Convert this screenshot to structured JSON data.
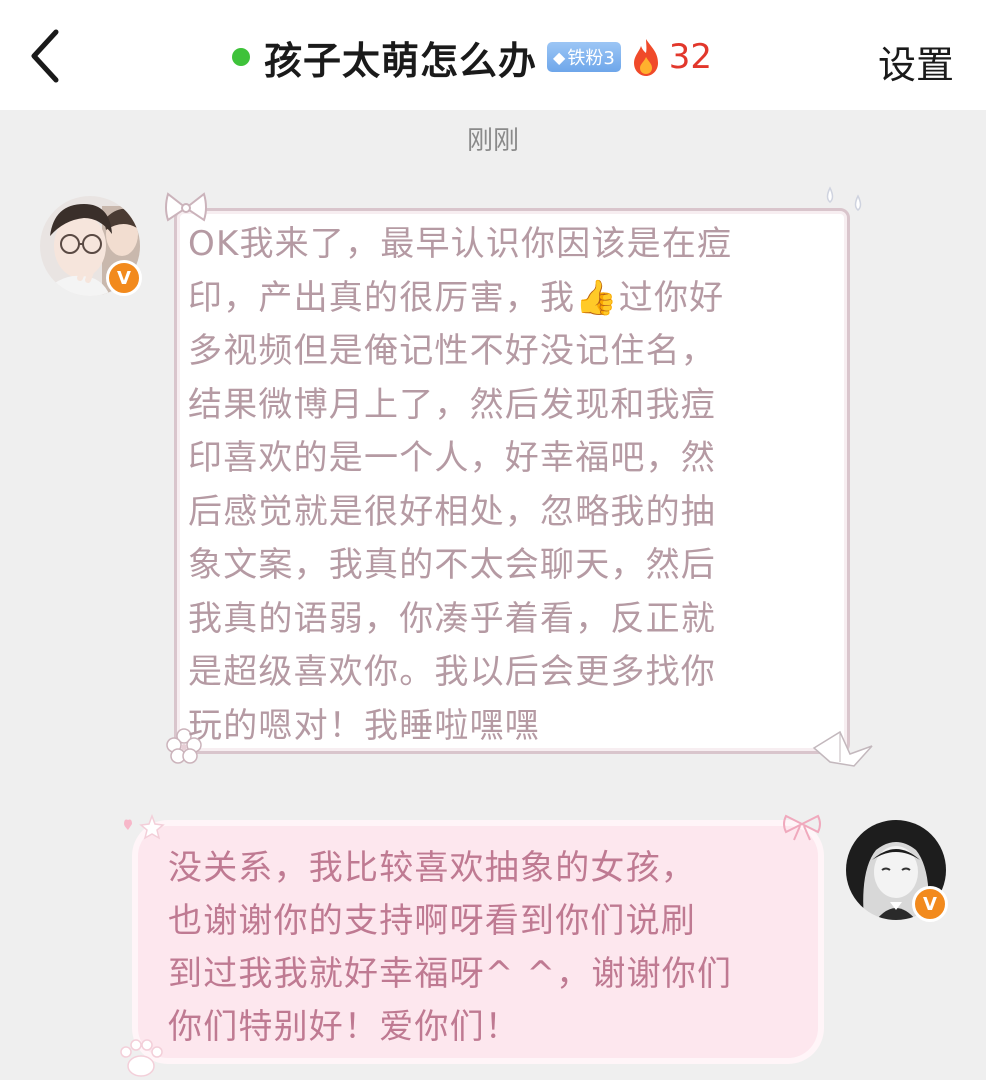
{
  "header": {
    "back_icon": "chevron-left-icon",
    "title": "孩子太萌怎么办",
    "online_color": "#3ec23a",
    "fan_badge": "铁粉3",
    "heat_icon": "fire-icon",
    "heat_count": "32",
    "settings_label": "设置"
  },
  "timestamp": "刚刚",
  "messages": [
    {
      "direction": "incoming",
      "lines": [
        "OK我来了，最早认识你因该是在痘",
        "印，产出真的很厉害，我",
        "过你好",
        "多视频但是俺记性不好没记住名，",
        "结果微博月上了，然后发现和我痘",
        "印喜欢的是一个人，好幸福吧，然",
        "后感觉就是很好相处，忽略我的抽",
        "象文案，我真的不太会聊天，然后",
        "我真的语弱，你凑乎着看，反正就",
        "是超级喜欢你。我以后会更多找你",
        "玩的嗯对！我睡啦嘿嘿"
      ],
      "emoji": "👍",
      "badge": "V"
    },
    {
      "direction": "outgoing",
      "lines": [
        "没关系，我比较喜欢抽象的女孩，",
        "也谢谢你的支持啊呀看到你们说刷",
        "到过我我就好幸福呀^ ^，谢谢你们",
        "你们特别好！爱你们！"
      ],
      "badge": "V"
    }
  ],
  "colors": {
    "incoming_text": "#b59aa3",
    "outgoing_text": "#bf7a92",
    "outgoing_bubble": "#fde7ee",
    "heat": "#e2372b",
    "verified": "#f28a1d"
  }
}
